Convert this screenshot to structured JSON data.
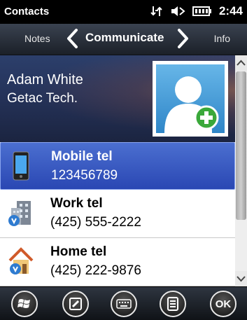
{
  "status_bar": {
    "app_title": "Contacts",
    "time": "2:44"
  },
  "tabs": {
    "left": "Notes",
    "center": "Communicate",
    "right": "Info"
  },
  "contact": {
    "name": "Adam White",
    "company": "Getac Tech."
  },
  "list": [
    {
      "label": "Mobile tel",
      "value": "123456789",
      "icon": "mobile-phone-icon",
      "selected": true
    },
    {
      "label": "Work tel",
      "value": "(425) 555-2222",
      "icon": "office-building-icon",
      "selected": false
    },
    {
      "label": "Home tel",
      "value": "(425) 222-9876",
      "icon": "house-icon",
      "selected": false
    }
  ],
  "bottom_bar": {
    "ok_label": "OK",
    "icons": [
      "windows-start-icon",
      "edit-icon",
      "keyboard-icon",
      "menu-icon",
      "ok-icon"
    ]
  },
  "colors": {
    "selection": "#2a47b3",
    "header": "#25335a",
    "accent_green": "#3aa83a"
  }
}
